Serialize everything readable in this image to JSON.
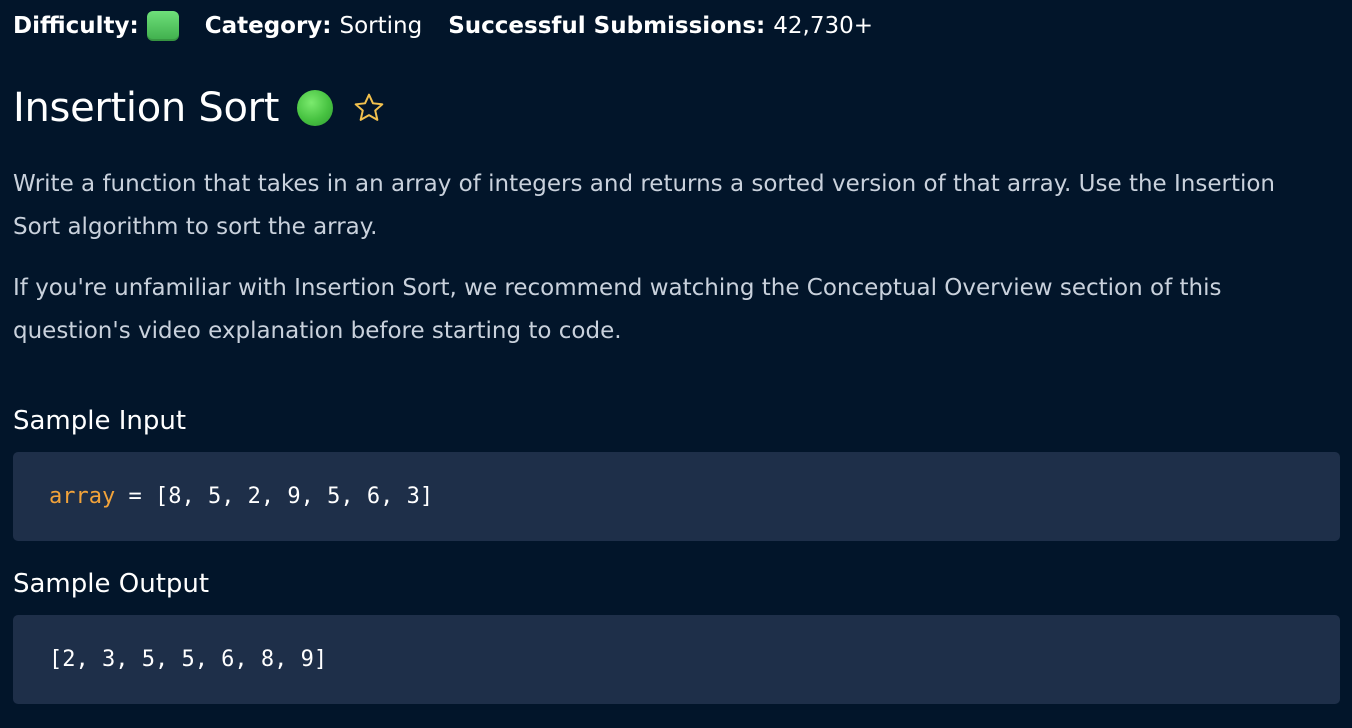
{
  "meta": {
    "difficulty_label": "Difficulty:",
    "category_label": "Category:",
    "category_value": "Sorting",
    "submissions_label": "Successful Submissions:",
    "submissions_value": "42,730+"
  },
  "colors": {
    "background": "#02152a",
    "code_background": "#1e2f49",
    "difficulty_green": "#47c241",
    "star_outline": "#f2c14e",
    "code_variable": "#f2a33a"
  },
  "question": {
    "title": "Insertion Sort",
    "difficulty_icon": "green-circle-icon",
    "favorite_icon": "star-outline-icon",
    "paragraphs": [
      "Write a function that takes in an array of integers and returns a sorted version of that array. Use the Insertion Sort algorithm to sort the array.",
      "If you're unfamiliar with Insertion Sort, we recommend watching the Conceptual Overview section of this question's video explanation before starting to code."
    ]
  },
  "sample_input": {
    "title": "Sample Input",
    "variable": "array",
    "rest": " = [8, 5, 2, 9, 5, 6, 3]"
  },
  "sample_output": {
    "title": "Sample Output",
    "code": "[2, 3, 5, 5, 6, 8, 9]"
  }
}
